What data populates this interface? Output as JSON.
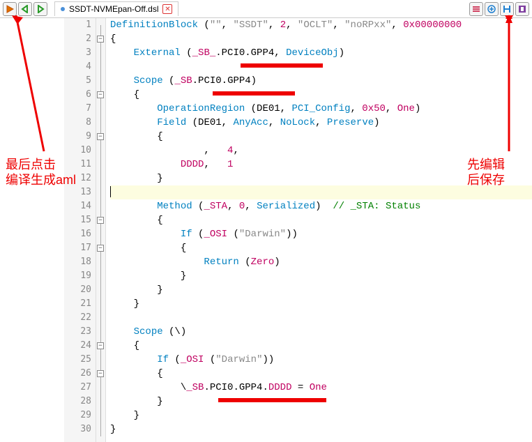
{
  "tab": {
    "title": "SSDT-NVMEpan-Off.dsl"
  },
  "annotations": {
    "left1": "最后点击",
    "left2": "编译生成aml",
    "right1": "先编辑",
    "right2": "后保存"
  },
  "lines": [
    {
      "n": 1,
      "html": "<span class='c-kw'>DefinitionBlock</span> (<span class='c-str'>\"\"</span>, <span class='c-str'>\"SSDT\"</span>, <span class='c-num'>2</span>, <span class='c-str'>\"OCLT\"</span>, <span class='c-str'>\"noRPxx\"</span>, <span class='c-num'>0x00000000</span>"
    },
    {
      "n": 2,
      "html": "{",
      "fold": "-"
    },
    {
      "n": 3,
      "html": "    <span class='c-kw'>External</span> (<span class='c-ident'>_SB_</span>.PCI0.GPP4, <span class='c-type'>DeviceObj</span>)"
    },
    {
      "n": 4,
      "html": ""
    },
    {
      "n": 5,
      "html": "    <span class='c-kw'>Scope</span> (<span class='c-ident'>_SB</span>.PCI0.GPP4)"
    },
    {
      "n": 6,
      "html": "    {",
      "fold": "-"
    },
    {
      "n": 7,
      "html": "        <span class='c-kw'>OperationRegion</span> (DE01, <span class='c-type'>PCI_Config</span>, <span class='c-num'>0x50</span>, <span class='c-num'>One</span>)"
    },
    {
      "n": 8,
      "html": "        <span class='c-kw'>Field</span> (DE01, <span class='c-type'>AnyAcc</span>, <span class='c-type'>NoLock</span>, <span class='c-type'>Preserve</span>)"
    },
    {
      "n": 9,
      "html": "        {",
      "fold": "-"
    },
    {
      "n": 10,
      "html": "                ,   <span class='c-num'>4</span>,"
    },
    {
      "n": 11,
      "html": "            <span class='c-field'>DDDD</span>,   <span class='c-num'>1</span>"
    },
    {
      "n": 12,
      "html": "        }"
    },
    {
      "n": 13,
      "html": "",
      "current": true
    },
    {
      "n": 14,
      "html": "        <span class='c-kw'>Method</span> (<span class='c-ident'>_STA</span>, <span class='c-num'>0</span>, <span class='c-type'>Serialized</span>)  <span class='c-cmt'>// _STA: Status</span>"
    },
    {
      "n": 15,
      "html": "        {",
      "fold": "-"
    },
    {
      "n": 16,
      "html": "            <span class='c-kw'>If</span> (<span class='c-ident'>_OSI</span> (<span class='c-str'>\"Darwin\"</span>))"
    },
    {
      "n": 17,
      "html": "            {",
      "fold": "-"
    },
    {
      "n": 18,
      "html": "                <span class='c-kw'>Return</span> (<span class='c-num'>Zero</span>)"
    },
    {
      "n": 19,
      "html": "            }"
    },
    {
      "n": 20,
      "html": "        }"
    },
    {
      "n": 21,
      "html": "    }"
    },
    {
      "n": 22,
      "html": ""
    },
    {
      "n": 23,
      "html": "    <span class='c-kw'>Scope</span> (\\)"
    },
    {
      "n": 24,
      "html": "    {",
      "fold": "-"
    },
    {
      "n": 25,
      "html": "        <span class='c-kw'>If</span> (<span class='c-ident'>_OSI</span> (<span class='c-str'>\"Darwin\"</span>))"
    },
    {
      "n": 26,
      "html": "        {",
      "fold": "-"
    },
    {
      "n": 27,
      "html": "            \\<span class='c-ident'>_SB</span>.PCI0.GPP4.<span class='c-field'>DDDD</span> = <span class='c-num'>One</span>"
    },
    {
      "n": 28,
      "html": "        }"
    },
    {
      "n": 29,
      "html": "    }"
    },
    {
      "n": 30,
      "html": "}"
    }
  ]
}
